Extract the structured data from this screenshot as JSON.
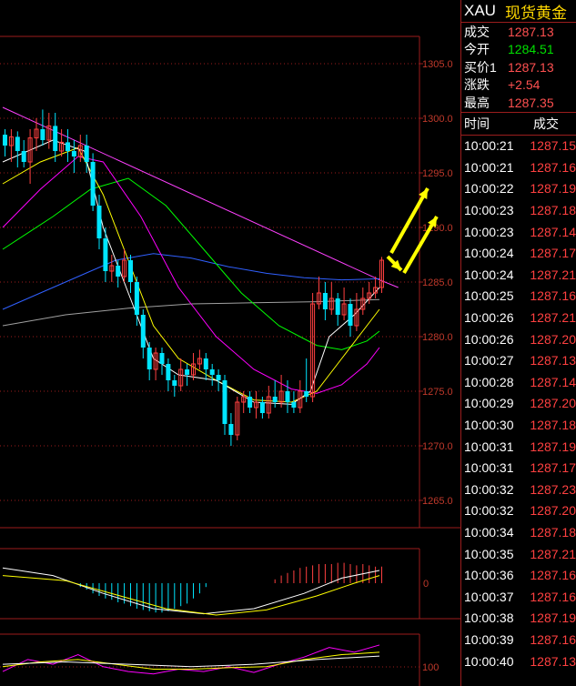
{
  "quote": {
    "symbol": "XAU",
    "name": "现货黄金",
    "rows": [
      {
        "label": "成交",
        "value": "1287.13",
        "color": "red"
      },
      {
        "label": "今开",
        "value": "1284.51",
        "color": "green"
      },
      {
        "label": "买价1",
        "value": "1287.13",
        "color": "red"
      },
      {
        "label": "涨跌",
        "value": "+2.54",
        "color": "red"
      },
      {
        "label": "最高",
        "value": "1287.35",
        "color": "red"
      }
    ]
  },
  "ticks": {
    "header_time": "时间",
    "header_price": "成交",
    "rows": [
      {
        "t": "10:00:21",
        "p": "1287.15"
      },
      {
        "t": "10:00:21",
        "p": "1287.16"
      },
      {
        "t": "10:00:22",
        "p": "1287.19"
      },
      {
        "t": "10:00:23",
        "p": "1287.18"
      },
      {
        "t": "10:00:23",
        "p": "1287.14"
      },
      {
        "t": "10:00:24",
        "p": "1287.17"
      },
      {
        "t": "10:00:24",
        "p": "1287.21"
      },
      {
        "t": "10:00:25",
        "p": "1287.16"
      },
      {
        "t": "10:00:26",
        "p": "1287.21"
      },
      {
        "t": "10:00:26",
        "p": "1287.20"
      },
      {
        "t": "10:00:27",
        "p": "1287.13"
      },
      {
        "t": "10:00:28",
        "p": "1287.14"
      },
      {
        "t": "10:00:29",
        "p": "1287.20"
      },
      {
        "t": "10:00:30",
        "p": "1287.18"
      },
      {
        "t": "10:00:31",
        "p": "1287.19"
      },
      {
        "t": "10:00:31",
        "p": "1287.17"
      },
      {
        "t": "10:00:32",
        "p": "1287.23"
      },
      {
        "t": "10:00:32",
        "p": "1287.20"
      },
      {
        "t": "10:00:34",
        "p": "1287.18"
      },
      {
        "t": "10:00:35",
        "p": "1287.21"
      },
      {
        "t": "10:00:36",
        "p": "1287.16"
      },
      {
        "t": "10:00:37",
        "p": "1287.16"
      },
      {
        "t": "10:00:38",
        "p": "1287.19"
      },
      {
        "t": "10:00:39",
        "p": "1287.16"
      },
      {
        "t": "10:00:40",
        "p": "1287.13"
      }
    ]
  },
  "colors": {
    "bg": "#000000",
    "grid": "#9b1d1d",
    "axis_text": "#c0392b",
    "up": "#ff4040",
    "down": "#00e5ff",
    "trend": "#ff40ff",
    "ma_white": "#ffffff",
    "ma_yellow": "#ffff00",
    "ma_magenta": "#ff00ff",
    "ma_green": "#00ff00",
    "ma_blue": "#3060ff",
    "ma_gray": "#a0a0a0",
    "arrow": "#ffff00"
  },
  "chart_data": {
    "type": "candlestick",
    "yticks": [
      1305.0,
      1300.0,
      1295.0,
      1290.0,
      1285.0,
      1280.0,
      1275.0,
      1270.0,
      1265.0
    ],
    "ylim": [
      1262.5,
      1307.5
    ],
    "macd_label": "0",
    "rsi_label": "100",
    "candles": [
      {
        "o": 1298.5,
        "c": 1297.5,
        "h": 1299.0,
        "l": 1296.5
      },
      {
        "o": 1297.5,
        "c": 1298.3,
        "h": 1299.0,
        "l": 1296.0
      },
      {
        "o": 1298.3,
        "c": 1297.0,
        "h": 1298.8,
        "l": 1295.5
      },
      {
        "o": 1297.0,
        "c": 1296.0,
        "h": 1298.0,
        "l": 1295.5
      },
      {
        "o": 1296.0,
        "c": 1298.2,
        "h": 1299.0,
        "l": 1294.0
      },
      {
        "o": 1298.2,
        "c": 1299.0,
        "h": 1300.0,
        "l": 1297.0
      },
      {
        "o": 1299.0,
        "c": 1298.0,
        "h": 1300.8,
        "l": 1297.5
      },
      {
        "o": 1298.0,
        "c": 1299.3,
        "h": 1300.5,
        "l": 1297.2
      },
      {
        "o": 1299.3,
        "c": 1297.0,
        "h": 1300.5,
        "l": 1296.0
      },
      {
        "o": 1297.0,
        "c": 1297.8,
        "h": 1299.0,
        "l": 1296.5
      },
      {
        "o": 1297.8,
        "c": 1297.0,
        "h": 1299.0,
        "l": 1296.0
      },
      {
        "o": 1297.0,
        "c": 1296.5,
        "h": 1298.0,
        "l": 1295.0
      },
      {
        "o": 1296.5,
        "c": 1297.5,
        "h": 1298.5,
        "l": 1296.0
      },
      {
        "o": 1297.5,
        "c": 1296.0,
        "h": 1298.5,
        "l": 1295.0
      },
      {
        "o": 1296.0,
        "c": 1292.0,
        "h": 1296.8,
        "l": 1291.5
      },
      {
        "o": 1292.0,
        "c": 1289.0,
        "h": 1293.0,
        "l": 1288.0
      },
      {
        "o": 1289.0,
        "c": 1286.0,
        "h": 1290.0,
        "l": 1285.0
      },
      {
        "o": 1286.0,
        "c": 1286.5,
        "h": 1287.5,
        "l": 1285.0
      },
      {
        "o": 1286.5,
        "c": 1285.5,
        "h": 1287.0,
        "l": 1284.5
      },
      {
        "o": 1285.5,
        "c": 1287.0,
        "h": 1288.0,
        "l": 1285.0
      },
      {
        "o": 1287.0,
        "c": 1285.0,
        "h": 1287.5,
        "l": 1284.0
      },
      {
        "o": 1285.0,
        "c": 1282.0,
        "h": 1285.5,
        "l": 1281.0
      },
      {
        "o": 1282.0,
        "c": 1279.0,
        "h": 1282.5,
        "l": 1278.0
      },
      {
        "o": 1279.0,
        "c": 1277.0,
        "h": 1279.5,
        "l": 1276.0
      },
      {
        "o": 1277.0,
        "c": 1278.5,
        "h": 1279.0,
        "l": 1276.0
      },
      {
        "o": 1278.5,
        "c": 1277.5,
        "h": 1279.0,
        "l": 1276.5
      },
      {
        "o": 1277.5,
        "c": 1276.0,
        "h": 1278.0,
        "l": 1275.0
      },
      {
        "o": 1276.0,
        "c": 1275.5,
        "h": 1276.5,
        "l": 1274.5
      },
      {
        "o": 1275.5,
        "c": 1277.0,
        "h": 1278.0,
        "l": 1275.0
      },
      {
        "o": 1277.0,
        "c": 1276.5,
        "h": 1277.5,
        "l": 1275.5
      },
      {
        "o": 1276.5,
        "c": 1277.5,
        "h": 1278.5,
        "l": 1276.0
      },
      {
        "o": 1277.5,
        "c": 1278.0,
        "h": 1278.8,
        "l": 1277.0
      },
      {
        "o": 1278.0,
        "c": 1277.0,
        "h": 1278.5,
        "l": 1276.0
      },
      {
        "o": 1277.0,
        "c": 1276.5,
        "h": 1277.5,
        "l": 1275.5
      },
      {
        "o": 1276.5,
        "c": 1276.0,
        "h": 1277.0,
        "l": 1275.0
      },
      {
        "o": 1276.0,
        "c": 1272.0,
        "h": 1276.5,
        "l": 1271.0
      },
      {
        "o": 1272.0,
        "c": 1271.0,
        "h": 1273.0,
        "l": 1270.0
      },
      {
        "o": 1271.0,
        "c": 1274.0,
        "h": 1274.5,
        "l": 1270.5
      },
      {
        "o": 1274.0,
        "c": 1274.5,
        "h": 1275.0,
        "l": 1273.0
      },
      {
        "o": 1274.5,
        "c": 1273.5,
        "h": 1275.0,
        "l": 1273.0
      },
      {
        "o": 1273.5,
        "c": 1274.0,
        "h": 1275.0,
        "l": 1272.5
      },
      {
        "o": 1274.0,
        "c": 1273.0,
        "h": 1274.5,
        "l": 1272.5
      },
      {
        "o": 1273.0,
        "c": 1274.5,
        "h": 1275.5,
        "l": 1272.5
      },
      {
        "o": 1274.5,
        "c": 1274.0,
        "h": 1276.0,
        "l": 1273.5
      },
      {
        "o": 1274.0,
        "c": 1275.0,
        "h": 1276.5,
        "l": 1273.5
      },
      {
        "o": 1275.0,
        "c": 1274.0,
        "h": 1276.0,
        "l": 1273.0
      },
      {
        "o": 1274.0,
        "c": 1273.5,
        "h": 1275.0,
        "l": 1273.0
      },
      {
        "o": 1273.5,
        "c": 1275.0,
        "h": 1276.0,
        "l": 1273.0
      },
      {
        "o": 1275.0,
        "c": 1274.5,
        "h": 1278.0,
        "l": 1274.0
      },
      {
        "o": 1274.5,
        "c": 1283.0,
        "h": 1284.0,
        "l": 1274.0
      },
      {
        "o": 1283.0,
        "c": 1284.0,
        "h": 1285.5,
        "l": 1282.5
      },
      {
        "o": 1284.0,
        "c": 1282.5,
        "h": 1285.0,
        "l": 1281.5
      },
      {
        "o": 1282.5,
        "c": 1283.5,
        "h": 1285.0,
        "l": 1282.0
      },
      {
        "o": 1283.5,
        "c": 1282.0,
        "h": 1284.0,
        "l": 1281.0
      },
      {
        "o": 1282.0,
        "c": 1283.0,
        "h": 1284.5,
        "l": 1281.5
      },
      {
        "o": 1283.0,
        "c": 1281.0,
        "h": 1283.5,
        "l": 1280.0
      },
      {
        "o": 1281.0,
        "c": 1282.5,
        "h": 1284.0,
        "l": 1280.5
      },
      {
        "o": 1282.5,
        "c": 1283.5,
        "h": 1284.5,
        "l": 1282.0
      },
      {
        "o": 1283.5,
        "c": 1284.0,
        "h": 1285.0,
        "l": 1283.0
      },
      {
        "o": 1284.0,
        "c": 1284.5,
        "h": 1285.5,
        "l": 1283.5
      },
      {
        "o": 1284.5,
        "c": 1287.0,
        "h": 1287.3,
        "l": 1284.0
      }
    ],
    "lines": {
      "trend": [
        [
          0,
          1301.0
        ],
        [
          60,
          1285.2
        ],
        [
          63,
          1284.5
        ]
      ],
      "ma_white": [
        [
          0,
          1296
        ],
        [
          8,
          1298
        ],
        [
          13,
          1297
        ],
        [
          16,
          1290
        ],
        [
          20,
          1284
        ],
        [
          24,
          1278
        ],
        [
          28,
          1276.5
        ],
        [
          34,
          1276
        ],
        [
          40,
          1274
        ],
        [
          46,
          1273.8
        ],
        [
          49,
          1275
        ],
        [
          52,
          1280
        ],
        [
          56,
          1282
        ],
        [
          60,
          1284.5
        ]
      ],
      "ma_yellow": [
        [
          0,
          1294
        ],
        [
          6,
          1296
        ],
        [
          12,
          1297.3
        ],
        [
          16,
          1293
        ],
        [
          20,
          1287
        ],
        [
          24,
          1281
        ],
        [
          28,
          1278
        ],
        [
          34,
          1276
        ],
        [
          40,
          1274.2
        ],
        [
          46,
          1274
        ],
        [
          50,
          1275
        ],
        [
          54,
          1278
        ],
        [
          58,
          1281
        ],
        [
          60,
          1282.5
        ]
      ],
      "ma_magenta": [
        [
          0,
          1290
        ],
        [
          6,
          1293.5
        ],
        [
          12,
          1296.5
        ],
        [
          16,
          1296
        ],
        [
          22,
          1291
        ],
        [
          28,
          1284.5
        ],
        [
          34,
          1280
        ],
        [
          40,
          1277
        ],
        [
          46,
          1275.2
        ],
        [
          50,
          1274.8
        ],
        [
          54,
          1275.6
        ],
        [
          58,
          1277.5
        ],
        [
          60,
          1279
        ]
      ],
      "ma_green": [
        [
          0,
          1288
        ],
        [
          8,
          1291
        ],
        [
          14,
          1293.5
        ],
        [
          20,
          1294.5
        ],
        [
          26,
          1292
        ],
        [
          32,
          1288
        ],
        [
          38,
          1284
        ],
        [
          44,
          1281
        ],
        [
          50,
          1279.2
        ],
        [
          54,
          1278.8
        ],
        [
          58,
          1279.6
        ],
        [
          60,
          1280.5
        ]
      ],
      "ma_blue": [
        [
          0,
          1282.5
        ],
        [
          6,
          1284
        ],
        [
          12,
          1285.5
        ],
        [
          18,
          1287
        ],
        [
          24,
          1287.6
        ],
        [
          30,
          1287.2
        ],
        [
          36,
          1286.4
        ],
        [
          42,
          1285.8
        ],
        [
          48,
          1285.4
        ],
        [
          54,
          1285.2
        ],
        [
          60,
          1285.3
        ]
      ],
      "ma_gray": [
        [
          0,
          1281
        ],
        [
          10,
          1282
        ],
        [
          20,
          1282.6
        ],
        [
          30,
          1283
        ],
        [
          40,
          1283.1
        ],
        [
          50,
          1283.2
        ],
        [
          60,
          1283.4
        ]
      ]
    },
    "macd": {
      "hist": [
        0,
        0,
        0,
        0,
        0,
        0,
        0,
        0,
        0,
        0,
        0,
        0,
        -0.3,
        -0.5,
        -0.8,
        -1.0,
        -1.2,
        -1.3,
        -1.5,
        -1.6,
        -1.8,
        -2.0,
        -2.1,
        -2.2,
        -2.3,
        -2.3,
        -2.2,
        -2.0,
        -1.8,
        -1.6,
        -1.2,
        -0.8,
        -0.3,
        0,
        0,
        0,
        0,
        0,
        0,
        0,
        0,
        0,
        0,
        0.3,
        0.6,
        0.8,
        1.0,
        1.2,
        1.3,
        1.4,
        1.5,
        1.5,
        1.5,
        1.6,
        1.6,
        1.5,
        1.4,
        1.5,
        1.4,
        1.3,
        1.3
      ],
      "dif": [
        [
          0,
          1.2
        ],
        [
          8,
          0.6
        ],
        [
          16,
          -0.8
        ],
        [
          24,
          -2.0
        ],
        [
          32,
          -2.4
        ],
        [
          40,
          -2.0
        ],
        [
          48,
          -0.8
        ],
        [
          54,
          0.4
        ],
        [
          60,
          1.0
        ]
      ],
      "dea": [
        [
          0,
          0.6
        ],
        [
          10,
          0.2
        ],
        [
          18,
          -0.9
        ],
        [
          26,
          -2.0
        ],
        [
          34,
          -2.5
        ],
        [
          42,
          -2.1
        ],
        [
          50,
          -1.0
        ],
        [
          56,
          0.0
        ],
        [
          60,
          0.6
        ]
      ]
    },
    "rsi": {
      "line1": [
        [
          0,
          30
        ],
        [
          4,
          55
        ],
        [
          8,
          45
        ],
        [
          12,
          65
        ],
        [
          16,
          40
        ],
        [
          20,
          30
        ],
        [
          24,
          25
        ],
        [
          28,
          35
        ],
        [
          32,
          30
        ],
        [
          36,
          40
        ],
        [
          40,
          28
        ],
        [
          44,
          45
        ],
        [
          48,
          60
        ],
        [
          52,
          80
        ],
        [
          56,
          70
        ],
        [
          60,
          85
        ]
      ],
      "line2": [
        [
          0,
          40
        ],
        [
          6,
          50
        ],
        [
          12,
          55
        ],
        [
          18,
          45
        ],
        [
          24,
          35
        ],
        [
          30,
          35
        ],
        [
          36,
          38
        ],
        [
          42,
          40
        ],
        [
          48,
          55
        ],
        [
          54,
          65
        ],
        [
          60,
          70
        ]
      ],
      "line3": [
        [
          0,
          45
        ],
        [
          10,
          50
        ],
        [
          20,
          45
        ],
        [
          30,
          40
        ],
        [
          40,
          45
        ],
        [
          50,
          55
        ],
        [
          60,
          62
        ]
      ]
    }
  }
}
